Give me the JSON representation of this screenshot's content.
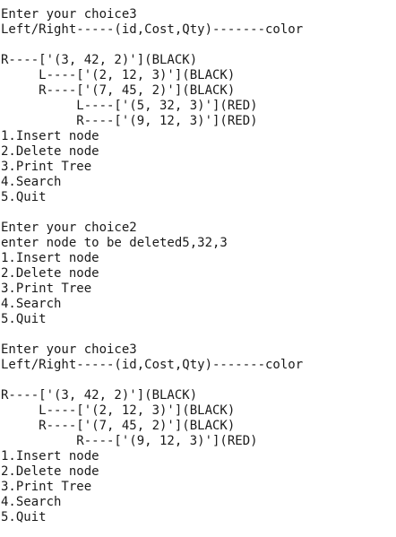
{
  "terminal": {
    "lines": [
      "Enter your choice3",
      "Left/Right-----(id,Cost,Qty)-------color",
      "",
      "R----['(3, 42, 2)'](BLACK)",
      "     L----['(2, 12, 3)'](BLACK)",
      "     R----['(7, 45, 2)'](BLACK)",
      "          L----['(5, 32, 3)'](RED)",
      "          R----['(9, 12, 3)'](RED)",
      "1.Insert node",
      "2.Delete node",
      "3.Print Tree",
      "4.Search",
      "5.Quit",
      "",
      "Enter your choice2",
      "enter node to be deleted5,32,3",
      "1.Insert node",
      "2.Delete node",
      "3.Print Tree",
      "4.Search",
      "5.Quit",
      "",
      "Enter your choice3",
      "Left/Right-----(id,Cost,Qty)-------color",
      "",
      "R----['(3, 42, 2)'](BLACK)",
      "     L----['(2, 12, 3)'](BLACK)",
      "     R----['(7, 45, 2)'](BLACK)",
      "          R----['(9, 12, 3)'](RED)",
      "1.Insert node",
      "2.Delete node",
      "3.Print Tree",
      "4.Search",
      "5.Quit"
    ]
  }
}
